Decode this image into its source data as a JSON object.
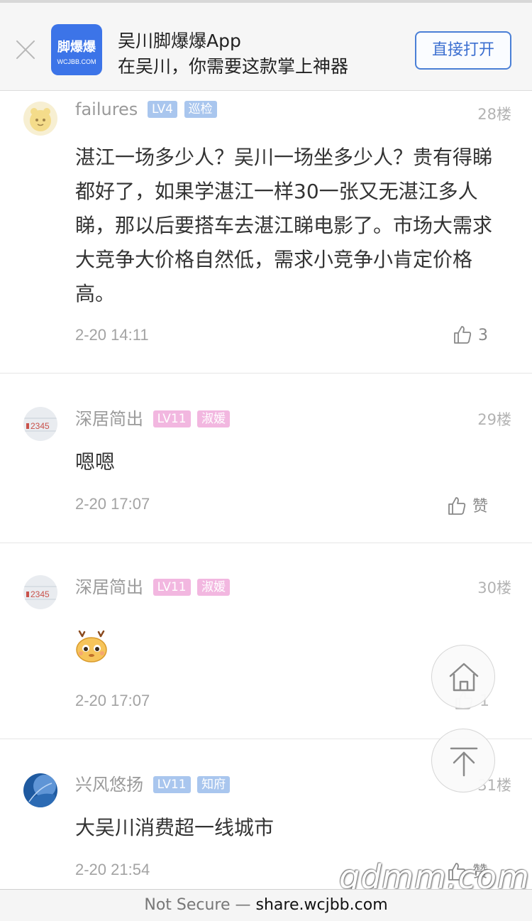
{
  "banner": {
    "logo_main": "脚爆爆",
    "logo_sub": "WCJBB.COM",
    "title": "吴川脚爆爆App",
    "subtitle": "在吴川，你需要这款掌上神器",
    "open_label": "直接打开"
  },
  "comments": [
    {
      "user": "failures",
      "level": "LV4",
      "role": "巡检",
      "floor": "28楼",
      "text": "湛江一场多少人？吴川一场坐多少人？贵有得睇都好了，如果学湛江一样30一张又无湛江多人睇，那以后要搭车去湛江睇电影了。市场大需求大竞争大价格自然低，需求小竞争小肯定价格高。",
      "time": "2-20 14:11",
      "likes": "3"
    },
    {
      "user": "深居简出",
      "level": "LV11",
      "role": "淑媛",
      "floor": "29楼",
      "text": "嗯嗯",
      "time": "2-20 17:07",
      "likes": "赞"
    },
    {
      "user": "深居简出",
      "level": "LV11",
      "role": "淑媛",
      "floor": "30楼",
      "text": "",
      "time": "2-20 17:07",
      "likes": "1"
    },
    {
      "user": "兴风悠扬",
      "level": "LV11",
      "role": "知府",
      "floor": "31楼",
      "text": "大吴川消费超一线城市",
      "time": "2-20 21:54",
      "likes": "赞"
    }
  ],
  "avatar_text": "2345",
  "watermark": "gdmm.com",
  "address_bar": {
    "security": "Not Secure —",
    "host": "share.wcjbb.com"
  },
  "colors": {
    "brand_blue": "#3c74e8",
    "badge_blue": "#a9c6ee",
    "badge_pink": "#f2b7e0"
  }
}
